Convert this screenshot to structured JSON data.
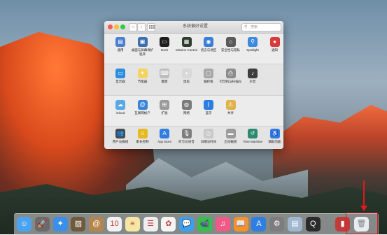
{
  "window": {
    "title": "系统偏好设置",
    "search_placeholder": "搜索",
    "back_glyph": "‹",
    "forward_glyph": "›"
  },
  "preferences": {
    "row1": [
      {
        "label": "通用",
        "icon": "general-icon",
        "color": "#4a7fd0",
        "glyph": "▤"
      },
      {
        "label": "桌面与屏幕保护程序",
        "icon": "desktop-icon",
        "color": "#3b6fae",
        "glyph": "▣"
      },
      {
        "label": "Dock",
        "icon": "dock-icon",
        "color": "#1d1d1d",
        "glyph": "▭"
      },
      {
        "label": "Mission Control",
        "icon": "mission-control-icon",
        "color": "#2f3d2e",
        "glyph": "▦"
      },
      {
        "label": "语言与地区",
        "icon": "language-icon",
        "color": "#3a7ed8",
        "glyph": "◉"
      },
      {
        "label": "安全性与隐私",
        "icon": "security-icon",
        "color": "#5a5a5a",
        "glyph": "⌂"
      },
      {
        "label": "Spotlight",
        "icon": "spotlight-icon",
        "color": "#3c8ae0",
        "glyph": "⚲"
      },
      {
        "label": "通知",
        "icon": "notifications-icon",
        "color": "#d93b3b",
        "glyph": "●"
      }
    ],
    "row2": [
      {
        "label": "显示器",
        "icon": "displays-icon",
        "color": "#2c8ee0",
        "glyph": "▭"
      },
      {
        "label": "节能器",
        "icon": "energy-saver-icon",
        "color": "#f4d35e",
        "glyph": "✦"
      },
      {
        "label": "键盘",
        "icon": "keyboard-icon",
        "color": "#bdbdbd",
        "glyph": "⌨"
      },
      {
        "label": "鼠标",
        "icon": "mouse-icon",
        "color": "#d8d8d8",
        "glyph": "◖"
      },
      {
        "label": "触控板",
        "icon": "trackpad-icon",
        "color": "#a8a8a8",
        "glyph": "▢"
      },
      {
        "label": "打印机与扫描仪",
        "icon": "printers-icon",
        "color": "#8c8c8c",
        "glyph": "⎙"
      },
      {
        "label": "声音",
        "icon": "sound-icon",
        "color": "#3d3d3d",
        "glyph": "♪"
      }
    ],
    "row3": [
      {
        "label": "iCloud",
        "icon": "icloud-icon",
        "color": "#5aa9e6",
        "glyph": "☁"
      },
      {
        "label": "互联网帐户",
        "icon": "internet-accounts-icon",
        "color": "#3a86d8",
        "glyph": "@"
      },
      {
        "label": "扩展",
        "icon": "extensions-icon",
        "color": "#9a9a9a",
        "glyph": "⊞"
      },
      {
        "label": "网络",
        "icon": "network-icon",
        "color": "#7a7a7a",
        "glyph": "◍"
      },
      {
        "label": "蓝牙",
        "icon": "bluetooth-icon",
        "color": "#2a7de1",
        "glyph": "ᛒ"
      },
      {
        "label": "共享",
        "icon": "sharing-icon",
        "color": "#e2b24a",
        "glyph": "⚠"
      }
    ],
    "row4": [
      {
        "label": "用户与群组",
        "icon": "users-icon",
        "color": "#4a4a4a",
        "glyph": "👥"
      },
      {
        "label": "家长控制",
        "icon": "parental-controls-icon",
        "color": "#e7b81f",
        "glyph": "☺"
      },
      {
        "label": "App Store",
        "icon": "app-store-icon",
        "color": "#2f7ee0",
        "glyph": "A"
      },
      {
        "label": "听写与语音",
        "icon": "dictation-icon",
        "color": "#7e7e7e",
        "glyph": "🎙"
      },
      {
        "label": "日期与时间",
        "icon": "date-time-icon",
        "color": "#c9c9c9",
        "glyph": "◷"
      },
      {
        "label": "启动磁盘",
        "icon": "startup-disk-icon",
        "color": "#9b9b9b",
        "glyph": "▬"
      },
      {
        "label": "Time Machine",
        "icon": "time-machine-icon",
        "color": "#2d8a6e",
        "glyph": "↺"
      },
      {
        "label": "辅助功能",
        "icon": "accessibility-icon",
        "color": "#2f7ee0",
        "glyph": "♿"
      }
    ]
  },
  "dock": {
    "apps": [
      {
        "name": "finder-icon",
        "color": "#4aa3f0",
        "glyph": "☺"
      },
      {
        "name": "launchpad-icon",
        "color": "#6a6a6a",
        "glyph": "🚀"
      },
      {
        "name": "safari-icon",
        "color": "#3c8ee6",
        "glyph": "✦"
      },
      {
        "name": "photo-app-icon",
        "color": "#6f5a3d",
        "glyph": "▨"
      },
      {
        "name": "contacts-icon",
        "color": "#b4864d",
        "glyph": "@"
      },
      {
        "name": "calendar-icon",
        "color": "#f2f2f2",
        "glyph": "10"
      },
      {
        "name": "notes-icon",
        "color": "#f6e6a3",
        "glyph": "≡"
      },
      {
        "name": "reminders-icon",
        "color": "#eeeeee",
        "glyph": "☰"
      },
      {
        "name": "photos-icon",
        "color": "#f5f5f5",
        "glyph": "✿"
      },
      {
        "name": "messages-icon",
        "color": "#3aa0f0",
        "glyph": "💬"
      },
      {
        "name": "facetime-icon",
        "color": "#34c04a",
        "glyph": "📹"
      },
      {
        "name": "itunes-icon",
        "color": "#f05a86",
        "glyph": "♫"
      },
      {
        "name": "ibooks-icon",
        "color": "#f4922b",
        "glyph": "📖"
      },
      {
        "name": "app-store-dock-icon",
        "color": "#2f7ee0",
        "glyph": "A"
      },
      {
        "name": "system-preferences-icon",
        "color": "#7d7d7d",
        "glyph": "⚙"
      },
      {
        "name": "preview-icon",
        "color": "#9fb7cf",
        "glyph": "▤"
      },
      {
        "name": "quicktime-icon",
        "color": "#2b2b2b",
        "glyph": "Q"
      }
    ],
    "right": [
      {
        "name": "downloads-stack-icon",
        "color": "#c23b3b",
        "glyph": "▮"
      },
      {
        "name": "trash-icon",
        "color": "#e8ecef",
        "glyph": "🗑"
      }
    ]
  }
}
